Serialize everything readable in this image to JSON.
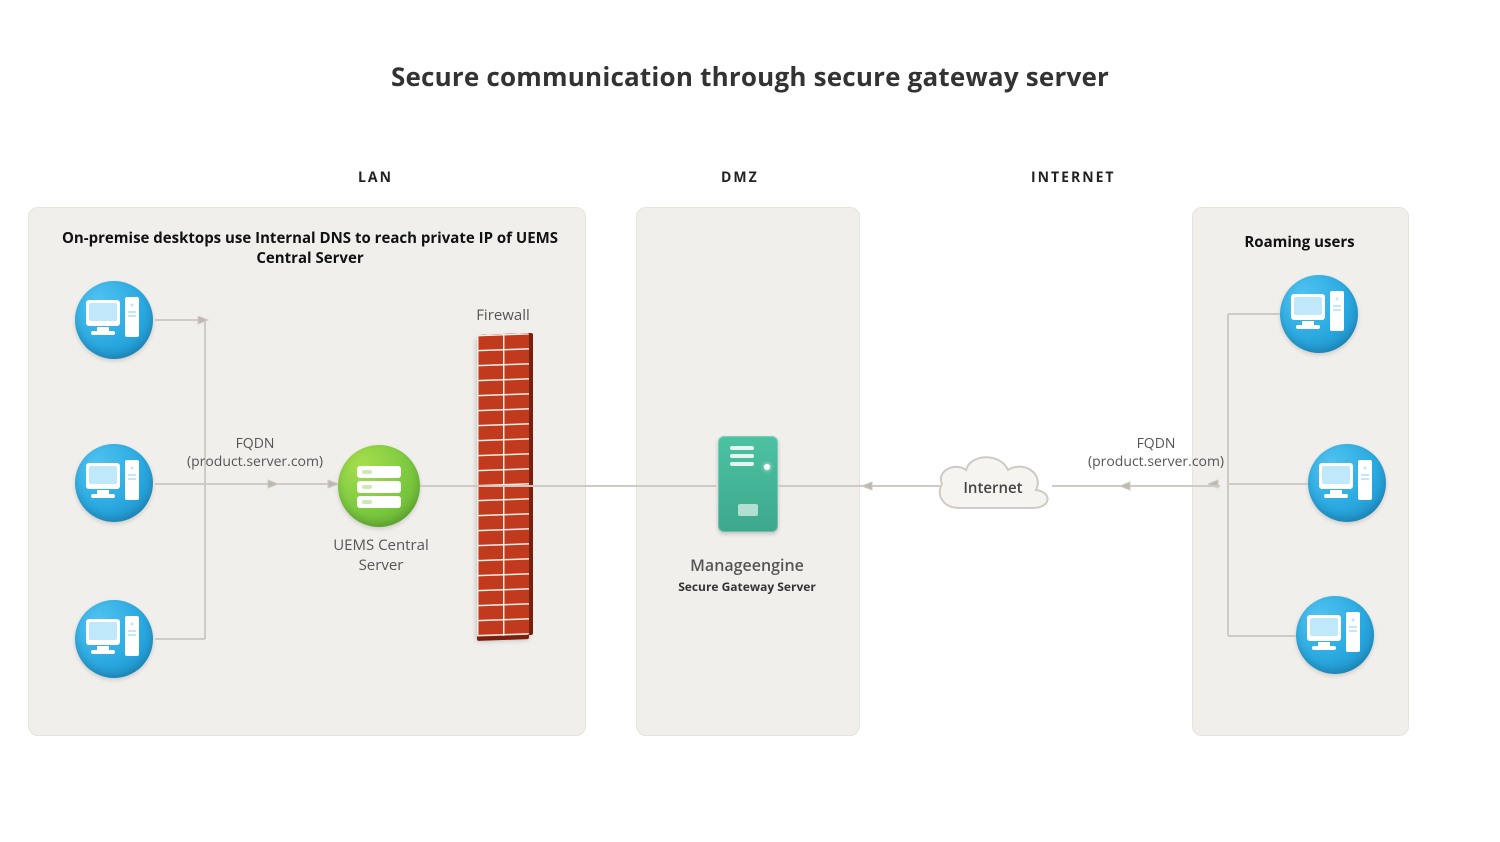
{
  "title": "Secure communication through secure gateway server",
  "zones": {
    "lan": {
      "label": "LAN"
    },
    "dmz": {
      "label": "DMZ"
    },
    "internet": {
      "label": "INTERNET"
    }
  },
  "lan": {
    "boxTitle": "On-premise desktops use Internal DNS to reach private IP of UEMS Central Server",
    "fqdnLabel": "FQDN\n(product.server.com)",
    "firewallLabel": "Firewall",
    "centralServerLabel": "UEMS Central Server"
  },
  "dmz": {
    "mainLabel": "Manageengine",
    "subLabel": "Secure Gateway Server"
  },
  "internetZone": {
    "cloudLabel": "Internet",
    "boxTitle": "Roaming users",
    "fqdnLabel": "FQDN\n(product.server.com)"
  }
}
